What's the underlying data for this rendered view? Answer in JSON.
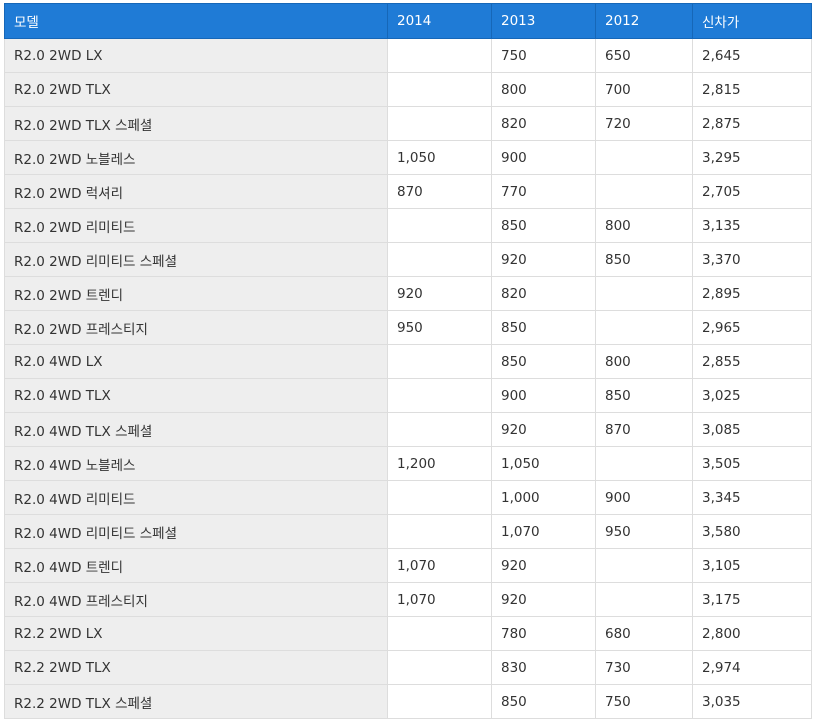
{
  "header": {
    "model": "모델",
    "y2014": "2014",
    "y2013": "2013",
    "y2012": "2012",
    "new_price": "신차가"
  },
  "rows": [
    {
      "model": "R2.0 2WD LX",
      "y2014": "",
      "y2013": "750",
      "y2012": "650",
      "new_price": "2,645"
    },
    {
      "model": "R2.0 2WD TLX",
      "y2014": "",
      "y2013": "800",
      "y2012": "700",
      "new_price": "2,815"
    },
    {
      "model": "R2.0 2WD TLX 스페셜",
      "y2014": "",
      "y2013": "820",
      "y2012": "720",
      "new_price": "2,875"
    },
    {
      "model": "R2.0 2WD 노블레스",
      "y2014": "1,050",
      "y2013": "900",
      "y2012": "",
      "new_price": "3,295"
    },
    {
      "model": "R2.0 2WD 럭셔리",
      "y2014": "870",
      "y2013": "770",
      "y2012": "",
      "new_price": "2,705"
    },
    {
      "model": "R2.0 2WD 리미티드",
      "y2014": "",
      "y2013": "850",
      "y2012": "800",
      "new_price": "3,135"
    },
    {
      "model": "R2.0 2WD 리미티드 스페셜",
      "y2014": "",
      "y2013": "920",
      "y2012": "850",
      "new_price": "3,370"
    },
    {
      "model": "R2.0 2WD 트렌디",
      "y2014": "920",
      "y2013": "820",
      "y2012": "",
      "new_price": "2,895"
    },
    {
      "model": "R2.0 2WD 프레스티지",
      "y2014": "950",
      "y2013": "850",
      "y2012": "",
      "new_price": "2,965"
    },
    {
      "model": "R2.0 4WD LX",
      "y2014": "",
      "y2013": "850",
      "y2012": "800",
      "new_price": "2,855"
    },
    {
      "model": "R2.0 4WD TLX",
      "y2014": "",
      "y2013": "900",
      "y2012": "850",
      "new_price": "3,025"
    },
    {
      "model": "R2.0 4WD TLX 스페셜",
      "y2014": "",
      "y2013": "920",
      "y2012": "870",
      "new_price": "3,085"
    },
    {
      "model": "R2.0 4WD 노블레스",
      "y2014": "1,200",
      "y2013": "1,050",
      "y2012": "",
      "new_price": "3,505"
    },
    {
      "model": "R2.0 4WD 리미티드",
      "y2014": "",
      "y2013": "1,000",
      "y2012": "900",
      "new_price": "3,345"
    },
    {
      "model": "R2.0 4WD 리미티드 스페셜",
      "y2014": "",
      "y2013": "1,070",
      "y2012": "950",
      "new_price": "3,580"
    },
    {
      "model": "R2.0 4WD 트렌디",
      "y2014": "1,070",
      "y2013": "920",
      "y2012": "",
      "new_price": "3,105"
    },
    {
      "model": "R2.0 4WD 프레스티지",
      "y2014": "1,070",
      "y2013": "920",
      "y2012": "",
      "new_price": "3,175"
    },
    {
      "model": "R2.2 2WD LX",
      "y2014": "",
      "y2013": "780",
      "y2012": "680",
      "new_price": "2,800"
    },
    {
      "model": "R2.2 2WD TLX",
      "y2014": "",
      "y2013": "830",
      "y2012": "730",
      "new_price": "2,974"
    },
    {
      "model": "R2.2 2WD TLX 스페셜",
      "y2014": "",
      "y2013": "850",
      "y2012": "750",
      "new_price": "3,035"
    }
  ],
  "colors": {
    "header_bg": "#1f7bd6",
    "header_text": "#ffffff",
    "model_cell_bg": "#eeeeee",
    "border": "#dddddd"
  }
}
